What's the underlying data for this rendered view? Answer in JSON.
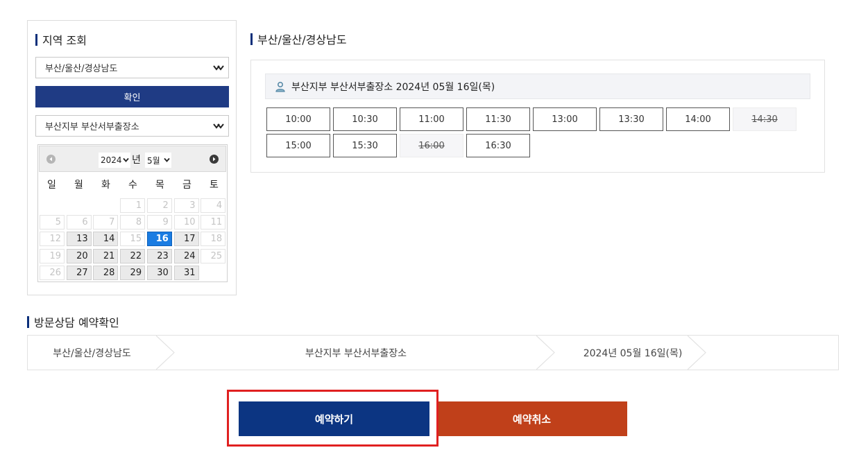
{
  "region_search": {
    "title": "지역 조회",
    "region_select": "부산/울산/경상남도",
    "confirm_label": "확인",
    "office_select": "부산지부 부산서부출장소"
  },
  "calendar": {
    "year": "2024",
    "year_suffix": "년",
    "month": "5월",
    "weekdays": [
      "일",
      "월",
      "화",
      "수",
      "목",
      "금",
      "토"
    ],
    "weeks": [
      [
        null,
        null,
        null,
        {
          "d": "1"
        },
        {
          "d": "2"
        },
        {
          "d": "3"
        },
        {
          "d": "4"
        }
      ],
      [
        {
          "d": "5"
        },
        {
          "d": "6"
        },
        {
          "d": "7"
        },
        {
          "d": "8"
        },
        {
          "d": "9"
        },
        {
          "d": "10"
        },
        {
          "d": "11"
        }
      ],
      [
        {
          "d": "12"
        },
        {
          "d": "13",
          "avail": true
        },
        {
          "d": "14",
          "avail": true
        },
        {
          "d": "15"
        },
        {
          "d": "16",
          "selected": true
        },
        {
          "d": "17",
          "avail": true
        },
        {
          "d": "18"
        }
      ],
      [
        {
          "d": "19"
        },
        {
          "d": "20",
          "avail": true
        },
        {
          "d": "21",
          "avail": true
        },
        {
          "d": "22",
          "avail": true
        },
        {
          "d": "23",
          "avail": true
        },
        {
          "d": "24",
          "avail": true
        },
        {
          "d": "25"
        }
      ],
      [
        {
          "d": "26"
        },
        {
          "d": "27",
          "avail": true
        },
        {
          "d": "28",
          "avail": true
        },
        {
          "d": "29",
          "avail": true
        },
        {
          "d": "30",
          "avail": true
        },
        {
          "d": "31",
          "avail": true
        },
        null
      ]
    ]
  },
  "schedule": {
    "region_title": "부산/울산/경상남도",
    "info_text": "부산지부 부산서부출장소 2024년 05월 16일(목)",
    "slots": [
      {
        "time": "10:00",
        "available": true
      },
      {
        "time": "10:30",
        "available": true
      },
      {
        "time": "11:00",
        "available": true
      },
      {
        "time": "11:30",
        "available": true
      },
      {
        "time": "13:00",
        "available": true
      },
      {
        "time": "13:30",
        "available": true
      },
      {
        "time": "14:00",
        "available": true
      },
      {
        "time": "14:30",
        "available": false
      },
      {
        "time": "15:00",
        "available": true
      },
      {
        "time": "15:30",
        "available": true
      },
      {
        "time": "16:00",
        "available": false
      },
      {
        "time": "16:30",
        "available": true
      }
    ]
  },
  "confirmation": {
    "title": "방문상담 예약확인",
    "region": "부산/울산/경상남도",
    "office": "부산지부 부산서부출장소",
    "date": "2024년 05월 16일(목)",
    "time": ""
  },
  "actions": {
    "reserve_label": "예약하기",
    "cancel_label": "예약취소"
  },
  "colors": {
    "accent_navy": "#1f3b84",
    "reserve_blue": "#0c3582",
    "cancel_orange": "#c0401a",
    "selected_day": "#1a7ce2",
    "highlight_red": "#e02020"
  }
}
